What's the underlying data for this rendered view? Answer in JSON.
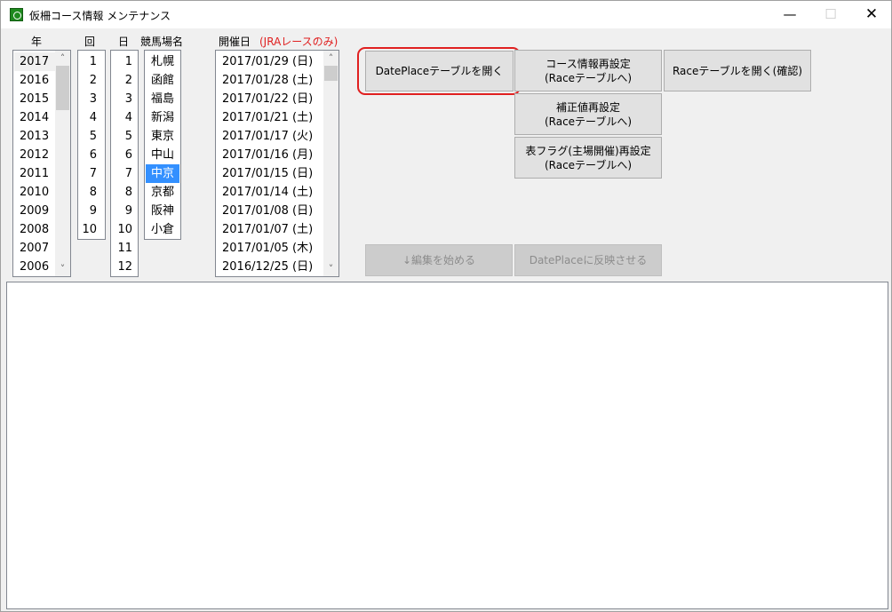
{
  "window": {
    "title": "仮柵コース情報 メンテナンス",
    "minimize": "—",
    "maximize": "☐",
    "close": "✕"
  },
  "labels": {
    "year": "年",
    "kai": "回",
    "day": "日",
    "venue": "競馬場名",
    "date": "開催日",
    "date_note": "(JRAレースのみ)"
  },
  "years": [
    "2017",
    "2016",
    "2015",
    "2014",
    "2013",
    "2012",
    "2011",
    "2010",
    "2009",
    "2008",
    "2007",
    "2006"
  ],
  "kai": [
    "1",
    "2",
    "3",
    "4",
    "5",
    "6",
    "7",
    "8",
    "9",
    "10"
  ],
  "days": [
    "1",
    "2",
    "3",
    "4",
    "5",
    "6",
    "7",
    "8",
    "9",
    "10",
    "11",
    "12"
  ],
  "venues": [
    "札幌",
    "函館",
    "福島",
    "新潟",
    "東京",
    "中山",
    "中京",
    "京都",
    "阪神",
    "小倉"
  ],
  "selected_venue": "中京",
  "dates": [
    "2017/01/29 (日)",
    "2017/01/28 (土)",
    "2017/01/22 (日)",
    "2017/01/21 (土)",
    "2017/01/17 (火)",
    "2017/01/16 (月)",
    "2017/01/15 (日)",
    "2017/01/14 (土)",
    "2017/01/08 (日)",
    "2017/01/07 (土)",
    "2017/01/05 (木)",
    "2016/12/25 (日)"
  ],
  "scroll": {
    "up": "˄",
    "down": "˅"
  },
  "buttons": {
    "open_dateplace": "DatePlaceテーブルを開く",
    "course_reset_1": "コース情報再設定",
    "course_reset_2": "(Raceテーブルへ)",
    "open_race": "Raceテーブルを開く(確認)",
    "correction_1": "補正値再設定",
    "correction_2": "(Raceテーブルへ)",
    "flag_1": "表フラグ(主場開催)再設定",
    "flag_2": "(Raceテーブルへ)",
    "start_edit": "↓編集を始める",
    "apply_dateplace": "DatePlaceに反映させる"
  },
  "colors": {
    "selection": "#3390ff",
    "highlight": "#e02020",
    "note": "#e02020"
  }
}
